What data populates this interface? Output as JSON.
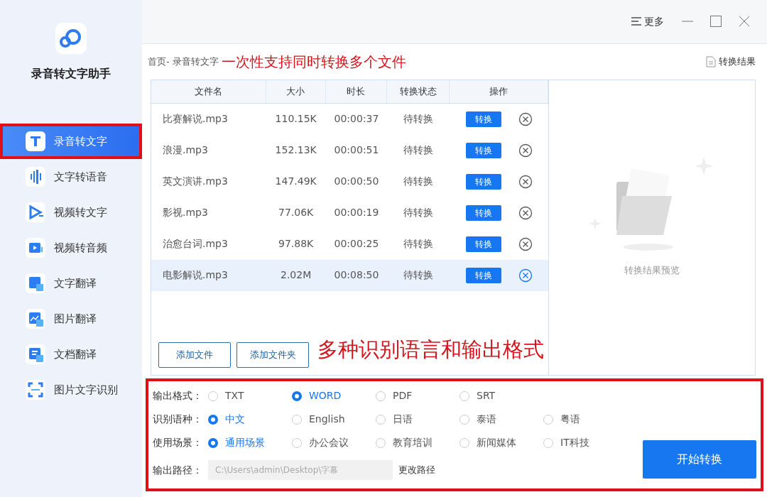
{
  "app": {
    "name": "录音转文字助手"
  },
  "sidebar": {
    "items": [
      {
        "label": "录音转文字",
        "kind": "text",
        "selected": true,
        "annotated": true
      },
      {
        "label": "文字转语音",
        "kind": "wave",
        "selected": false,
        "annotated": false
      },
      {
        "label": "视频转文字",
        "kind": "play",
        "selected": false,
        "annotated": false
      },
      {
        "label": "视频转音频",
        "kind": "video",
        "selected": false,
        "annotated": false
      },
      {
        "label": "文字翻译",
        "kind": "translate",
        "selected": false,
        "annotated": false
      },
      {
        "label": "图片翻译",
        "kind": "image",
        "selected": false,
        "annotated": false
      },
      {
        "label": "文档翻译",
        "kind": "doc",
        "selected": false,
        "annotated": false
      },
      {
        "label": "图片文字识别",
        "kind": "scan",
        "selected": false,
        "annotated": false
      }
    ]
  },
  "titlebar": {
    "menu_label": "更多"
  },
  "breadcrumb": "首页- 录音转文字",
  "annotations": [
    "一次性支持同时转换多个文件",
    "多种识别语言和输出格式"
  ],
  "result_link": "转换结果",
  "table": {
    "columns": [
      "文件名",
      "大小",
      "时长",
      "转换状态",
      "操作"
    ],
    "rows": [
      {
        "name": "比赛解说.mp3",
        "size": "110.15K",
        "duration": "00:00:37",
        "status": "待转换",
        "action": "转换",
        "selected": false
      },
      {
        "name": "浪漫.mp3",
        "size": "152.13K",
        "duration": "00:00:51",
        "status": "待转换",
        "action": "转换",
        "selected": false
      },
      {
        "name": "英文演讲.mp3",
        "size": "147.49K",
        "duration": "00:00:50",
        "status": "待转换",
        "action": "转换",
        "selected": false
      },
      {
        "name": "影视.mp3",
        "size": "77.06K",
        "duration": "00:00:19",
        "status": "待转换",
        "action": "转换",
        "selected": false
      },
      {
        "name": "治愈台词.mp3",
        "size": "97.88K",
        "duration": "00:00:25",
        "status": "待转换",
        "action": "转换",
        "selected": false
      },
      {
        "name": "电影解说.mp3",
        "size": "2.02M",
        "duration": "00:08:50",
        "status": "待转换",
        "action": "转换",
        "selected": true
      }
    ]
  },
  "buttons": [
    "添加文件",
    "添加文件夹"
  ],
  "preview": {
    "caption": "转换结果预览"
  },
  "options": {
    "annotated": true,
    "groups": [
      {
        "label": "输出格式：",
        "choices": [
          {
            "label": "TXT",
            "selected": false
          },
          {
            "label": "WORD",
            "selected": true
          },
          {
            "label": "PDF",
            "selected": false
          },
          {
            "label": "SRT",
            "selected": false
          }
        ]
      },
      {
        "label": "识别语种：",
        "choices": [
          {
            "label": "中文",
            "selected": true
          },
          {
            "label": "English",
            "selected": false
          },
          {
            "label": "日语",
            "selected": false
          },
          {
            "label": "泰语",
            "selected": false
          },
          {
            "label": "粤语",
            "selected": false
          }
        ]
      },
      {
        "label": "使用场景：",
        "choices": [
          {
            "label": "通用场景",
            "selected": true
          },
          {
            "label": "办公会议",
            "selected": false
          },
          {
            "label": "教育培训",
            "selected": false
          },
          {
            "label": "新闻媒体",
            "selected": false
          },
          {
            "label": "IT科技",
            "selected": false
          }
        ]
      }
    ],
    "path_label": "输出路径：",
    "path_value": "C:\\Users\\admin\\Desktop\\字幕",
    "change_path": "更改路径",
    "start": "开始转换"
  }
}
